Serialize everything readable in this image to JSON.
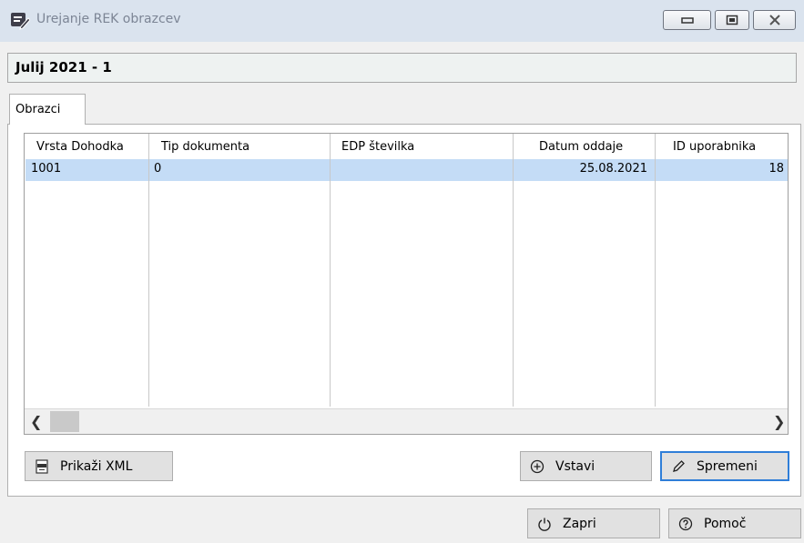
{
  "window": {
    "title": "Urejanje REK obrazcev"
  },
  "period": {
    "label": "Julij 2021 - 1"
  },
  "tabs": [
    {
      "label": "Obrazci"
    }
  ],
  "table": {
    "columns": [
      "Vrsta Dohodka",
      "Tip dokumenta",
      "EDP številka",
      "Datum oddaje",
      "ID uporabnika"
    ],
    "rows": [
      [
        "1001",
        "0",
        "",
        "25.08.2021",
        "18"
      ]
    ]
  },
  "buttons": {
    "show_xml": "Prikaži XML",
    "insert": "Vstavi",
    "edit": "Spremeni",
    "close": "Zapri",
    "help": "Pomoč"
  },
  "icons": {
    "app": "edit-form-icon",
    "minimize": "minimize-icon",
    "maximize": "maximize-icon",
    "close": "close-icon",
    "xml": "xml-file-icon",
    "insert": "plus-circle-icon",
    "edit": "pencil-icon",
    "power": "power-icon",
    "help": "question-circle-icon"
  },
  "colors": {
    "selection": "#c4dcf6",
    "default_button_border": "#2f7ed8",
    "titlebar": "#dae3ee"
  }
}
